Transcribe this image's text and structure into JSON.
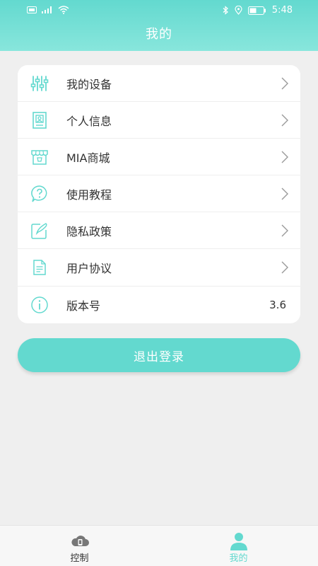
{
  "status_bar": {
    "left_icons": [
      "hd-icon",
      "signal-icon",
      "wifi-icon"
    ],
    "time": "5:48"
  },
  "header": {
    "title": "我的",
    "gradient_top": "#63d9cf",
    "gradient_bottom": "#88e6dc"
  },
  "menu": {
    "items": [
      {
        "label": "我的设备",
        "icon": "sliders-icon"
      },
      {
        "label": "个人信息",
        "icon": "profile-card-icon"
      },
      {
        "label": "MIA商城",
        "icon": "store-icon"
      },
      {
        "label": "使用教程",
        "icon": "question-icon"
      },
      {
        "label": "隐私政策",
        "icon": "edit-note-icon"
      },
      {
        "label": "用户协议",
        "icon": "document-icon"
      },
      {
        "label": "版本号",
        "icon": "info-icon",
        "value": "3.6"
      }
    ]
  },
  "logout": {
    "label": "退出登录"
  },
  "bottom_nav": {
    "items": [
      {
        "label": "控制",
        "icon": "cloud-phone-icon",
        "active": false
      },
      {
        "label": "我的",
        "icon": "person-icon",
        "active": true
      }
    ]
  },
  "colors": {
    "accent": "#63d9cf",
    "background": "#efefef",
    "icon": "#63d9cf",
    "inactive_nav": "#333333"
  }
}
